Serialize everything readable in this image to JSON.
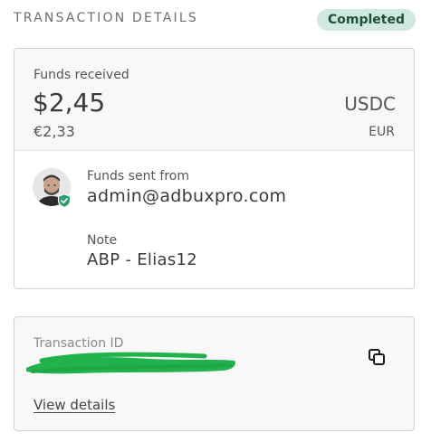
{
  "header": {
    "title": "TRANSACTION DETAILS",
    "status": "Completed"
  },
  "amount_card": {
    "funds_label": "Funds received",
    "amount": "$2,45",
    "currency": "USDC",
    "converted_amount": "€2,33",
    "converted_currency": "EUR",
    "sender_label": "Funds sent from",
    "sender": "admin@adbuxpro.com",
    "note_label": "Note",
    "note": "ABP - Elias12"
  },
  "transaction_card": {
    "id_label": "Transaction ID",
    "view_details": "View details"
  },
  "icons": [
    "avatar",
    "verified-shield-icon",
    "copy-icon"
  ],
  "colors": {
    "status_badge_bg": "#cfe9df",
    "status_badge_text": "#1f4e3a",
    "verified_shield": "#2e9b6b",
    "redaction": "#22b24c"
  }
}
